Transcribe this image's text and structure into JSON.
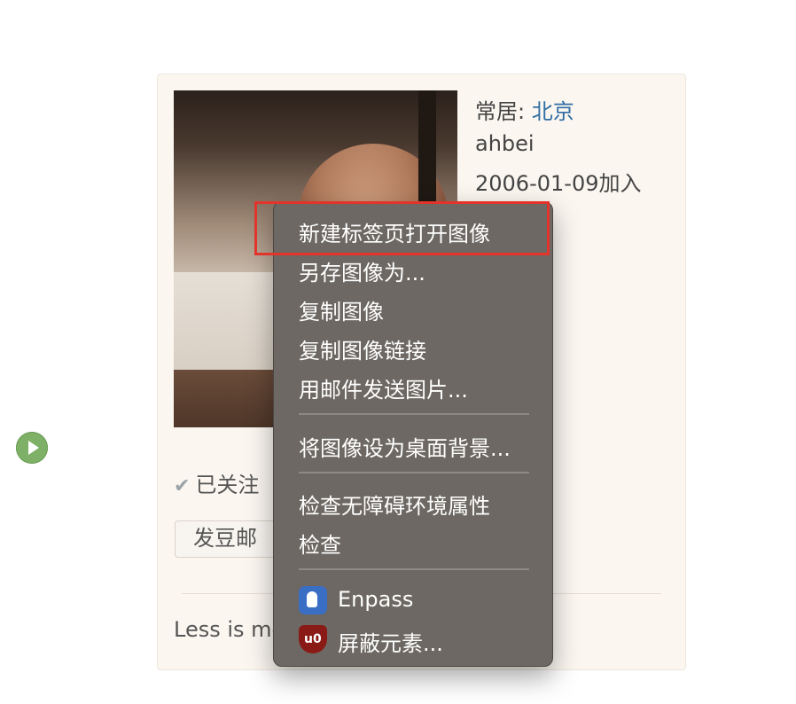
{
  "profile": {
    "residence_label": "常居:",
    "residence_city": "北京",
    "username": "ahbei",
    "joined": "2006-01-09加入",
    "followed_label": "已关注",
    "mail_button": "发豆邮",
    "motto": "Less is mo"
  },
  "context_menu": {
    "items": [
      {
        "label": "新建标签页打开图像"
      },
      {
        "label": "另存图像为..."
      },
      {
        "label": "复制图像"
      },
      {
        "label": "复制图像链接"
      },
      {
        "label": "用邮件发送图片..."
      },
      {
        "label": "将图像设为桌面背景..."
      },
      {
        "label": "检查无障碍环境属性"
      },
      {
        "label": "检查"
      },
      {
        "label": "Enpass",
        "icon": "enpass-icon"
      },
      {
        "label": "屏蔽元素...",
        "icon": "ublock-icon"
      }
    ]
  },
  "colors": {
    "highlight_border": "#e3342b",
    "link": "#2f6da3",
    "menu_bg": "#6d6863"
  }
}
